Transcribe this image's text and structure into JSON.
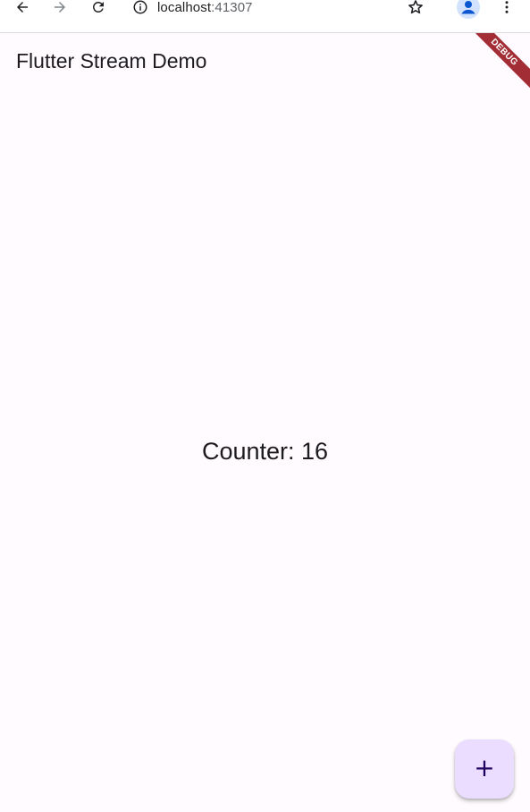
{
  "browser": {
    "url_host": "localhost",
    "url_port": ":41307",
    "icons": {
      "back": "arrow-left-icon",
      "forward": "arrow-right-icon",
      "reload": "reload-icon",
      "info": "info-icon",
      "bookmark": "star-icon",
      "profile": "profile-icon",
      "menu": "kebab-menu-icon"
    }
  },
  "app": {
    "title": "Flutter Stream Demo",
    "counter_text": "Counter: 16",
    "fab_label": "+",
    "debug_banner": "DEBUG",
    "colors": {
      "background": "#fffbfe",
      "fab": "#eaddff",
      "fab_icon": "#21005d",
      "debug_ribbon": "#a32d35"
    }
  }
}
